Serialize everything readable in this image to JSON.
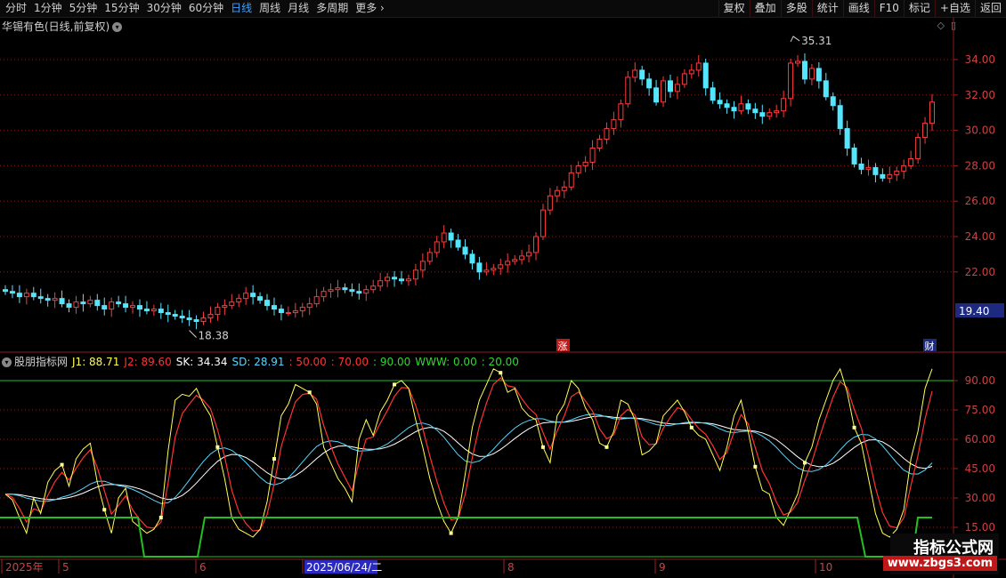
{
  "toolbar": {
    "periods": [
      "分时",
      "1分钟",
      "5分钟",
      "15分钟",
      "30分钟",
      "60分钟",
      "日线",
      "周线",
      "月线",
      "多周期",
      "更多"
    ],
    "active_period": "日线",
    "more_arrow": "›",
    "right_buttons": [
      "复权",
      "叠加",
      "多股",
      "统计",
      "画线",
      "F10",
      "标记",
      "+自选",
      "返回"
    ]
  },
  "main_chart": {
    "title": "华锡有色(日线,前复权)",
    "high_label": "35.31",
    "low_label": "18.38",
    "current_price_tag": "19.40",
    "marker_up": "涨",
    "marker_fin": "财",
    "y_ticks": [
      "34.00",
      "32.00",
      "30.00",
      "28.00",
      "26.00",
      "24.00",
      "22.00"
    ]
  },
  "indicator": {
    "name": "股朋指标网",
    "j1": "J1: 88.71",
    "j2": "J2: 89.60",
    "sk": "SK: 34.34",
    "sd": "SD: 28.91",
    "v50": ": 50.00",
    "v70": ": 70.00",
    "v90": ": 90.00",
    "www": "WWW: 0.00",
    "v20": ": 20.00",
    "y_ticks": [
      "90.00",
      "75.00",
      "60.00",
      "45.00",
      "30.00",
      "15.00"
    ]
  },
  "x_axis": {
    "labels": [
      "2025年",
      "5",
      "6",
      "2025/06/24/二",
      "8",
      "9",
      "10"
    ]
  },
  "watermark": {
    "title": "指标公式网",
    "url": "www.zbgs3.com"
  },
  "colors": {
    "up": "#ff3b3b",
    "down": "#55e6ff",
    "j1": "#ffff55",
    "j2": "#ff3333",
    "sk": "#55d6ff",
    "sd": "#ffffff",
    "green": "#22c022",
    "grid": "#7a1c1c",
    "active": "#3ea0ff"
  }
}
